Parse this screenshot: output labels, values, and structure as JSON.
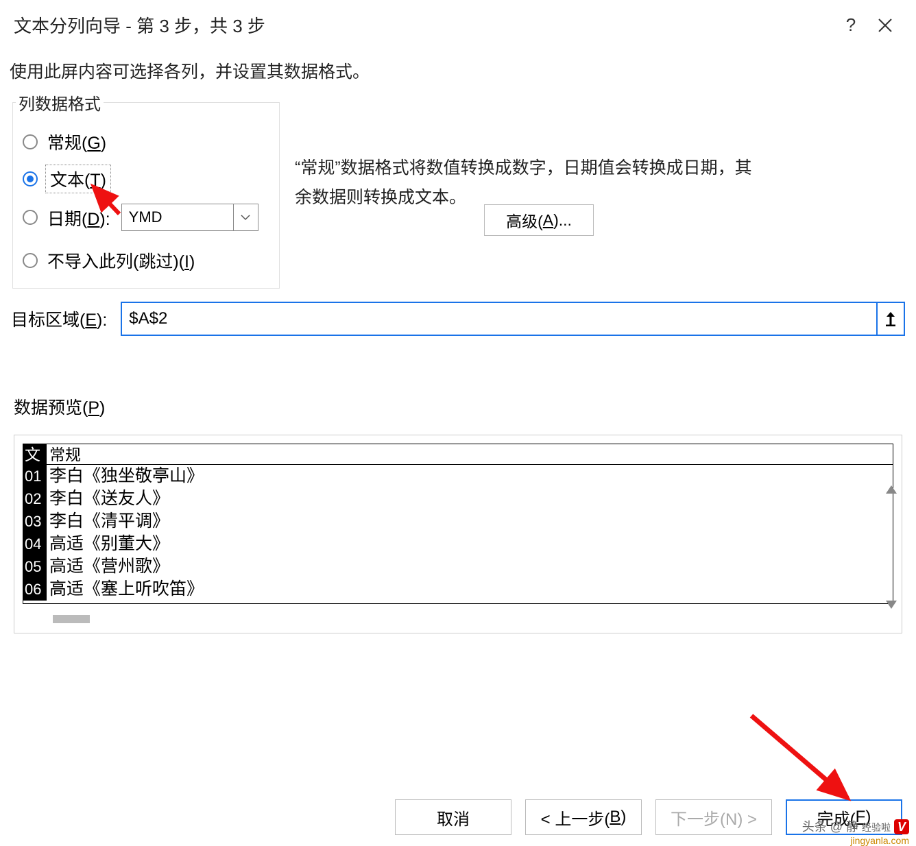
{
  "title": "文本分列向导 - 第 3 步，共 3 步",
  "instruction": "使用此屏内容可选择各列，并设置其数据格式。",
  "group_legend": "列数据格式",
  "radios": {
    "general": "常规(G)",
    "text": "文本(T)",
    "date": "日期(D):",
    "skip": "不导入此列(跳过)(I)"
  },
  "date_format": "YMD",
  "info_text": "“常规”数据格式将数值转换成数字，日期值会转换成日期，其余数据则转换成文本。",
  "advanced_label": "高级(A)...",
  "target_label": "目标区域(E):",
  "target_value": "$A$2",
  "preview_label": "数据预览(P)",
  "preview_headers": {
    "a": "文",
    "b": "常规"
  },
  "preview_rows": [
    {
      "a": "01",
      "b": "李白《独坐敬亭山》"
    },
    {
      "a": "02",
      "b": "李白《送友人》"
    },
    {
      "a": "03",
      "b": "李白《清平调》"
    },
    {
      "a": "04",
      "b": "高适《别董大》"
    },
    {
      "a": "05",
      "b": "高适《营州歌》"
    },
    {
      "a": "06",
      "b": "高适《塞上听吹笛》"
    }
  ],
  "buttons": {
    "cancel": "取消",
    "back": "< 上一步(B)",
    "next": "下一步(N) >",
    "finish": "完成(F)"
  },
  "watermark": {
    "line1": "头条 @ 静",
    "badge": "V",
    "site": "jingyanla.com",
    "mid": "经验啦"
  }
}
